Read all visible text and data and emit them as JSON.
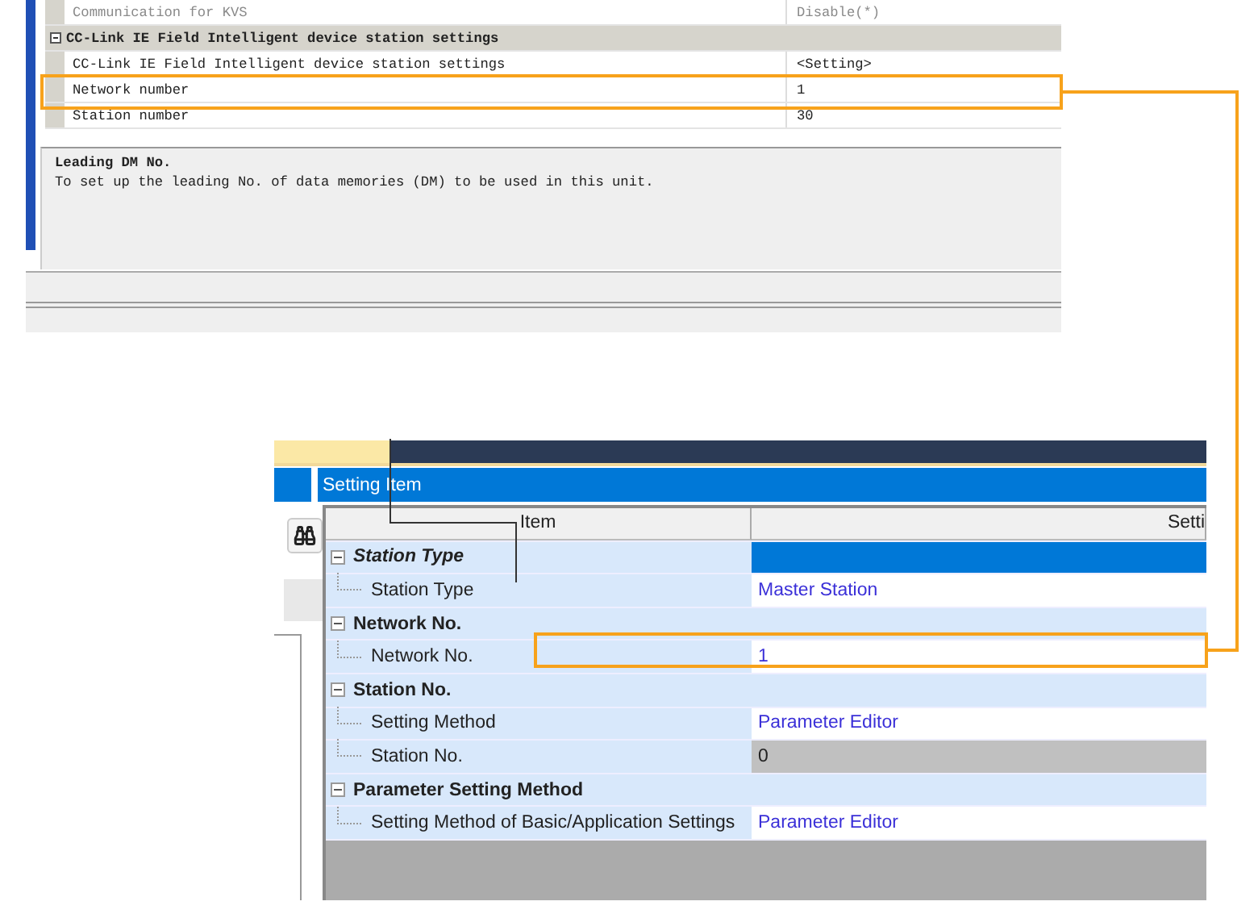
{
  "kvs_settings": {
    "rows": [
      {
        "kind": "row",
        "label": "Communication for KVS",
        "value": "Disable(*)",
        "disabled": true
      },
      {
        "kind": "group",
        "label": "CC-Link IE Field Intelligent device station settings",
        "expanded": true
      },
      {
        "kind": "row",
        "label": "CC-Link IE Field Intelligent device station settings",
        "value": "<Setting>",
        "disabled": false
      },
      {
        "kind": "row",
        "label": "Network number",
        "value": "1",
        "disabled": false
      },
      {
        "kind": "row",
        "label": "Station number",
        "value": "30",
        "disabled": false
      }
    ],
    "description": {
      "title": "Leading DM No.",
      "text": "To set up the leading No. of data memories (DM) to be used in this unit."
    }
  },
  "parameter_editor": {
    "header": "Setting Item",
    "columns": [
      "Item",
      "Setti"
    ],
    "rows": [
      {
        "kind": "group",
        "label": "Station Type",
        "selected": true,
        "expanded": true
      },
      {
        "kind": "item",
        "label": "Station Type",
        "value": "Master Station",
        "disabled": false
      },
      {
        "kind": "group",
        "label": "Network No.",
        "selected": false,
        "expanded": true
      },
      {
        "kind": "item",
        "label": "Network No.",
        "value": "1",
        "disabled": false
      },
      {
        "kind": "group",
        "label": "Station No.",
        "selected": false,
        "expanded": true
      },
      {
        "kind": "item",
        "label": "Setting Method",
        "value": "Parameter Editor",
        "disabled": false
      },
      {
        "kind": "item",
        "label": "Station No.",
        "value": "0",
        "disabled": true
      },
      {
        "kind": "group",
        "label": "Parameter Setting Method",
        "selected": false,
        "expanded": true
      },
      {
        "kind": "item",
        "label": "Setting Method of Basic/Application Settings",
        "value": "Parameter Editor",
        "disabled": false
      }
    ]
  }
}
